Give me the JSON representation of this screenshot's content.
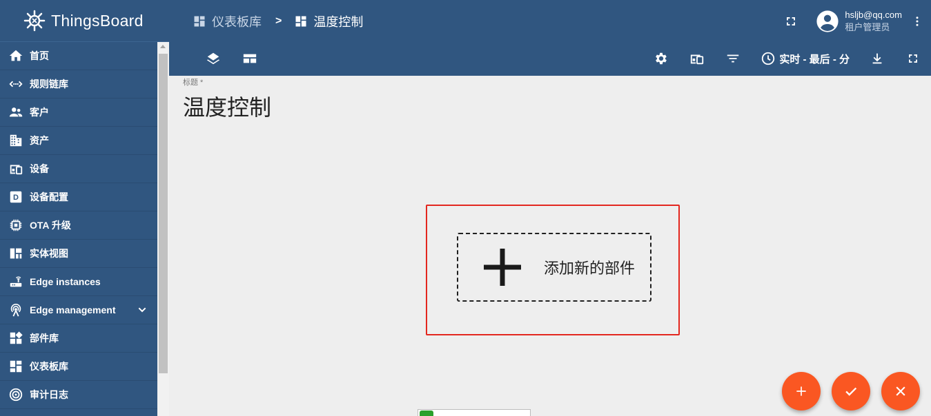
{
  "app": {
    "name": "ThingsBoard"
  },
  "sidebar": {
    "items": [
      {
        "label": "首页",
        "icon": "home-icon"
      },
      {
        "label": "规则链库",
        "icon": "rule-chain-icon"
      },
      {
        "label": "客户",
        "icon": "customers-icon"
      },
      {
        "label": "资产",
        "icon": "assets-icon"
      },
      {
        "label": "设备",
        "icon": "devices-icon"
      },
      {
        "label": "设备配置",
        "icon": "device-profile-icon"
      },
      {
        "label": "OTA 升级",
        "icon": "chip-icon"
      },
      {
        "label": "实体视图",
        "icon": "entity-view-icon"
      },
      {
        "label": "Edge instances",
        "icon": "router-icon"
      },
      {
        "label": "Edge management",
        "icon": "antenna-icon",
        "expandable": true
      },
      {
        "label": "部件库",
        "icon": "widgets-icon"
      },
      {
        "label": "仪表板库",
        "icon": "dashboard-icon"
      },
      {
        "label": "审计日志",
        "icon": "audit-log-icon"
      }
    ]
  },
  "header": {
    "breadcrumb": [
      {
        "label": "仪表板库",
        "icon": "dashboard-icon"
      },
      {
        "label": "温度控制",
        "icon": "dashboard-icon"
      }
    ],
    "separator": ">",
    "user": {
      "email": "hsljb@qq.com",
      "role": "租户管理员"
    }
  },
  "toolbar": {
    "time_window": "实时 - 最后 - 分"
  },
  "dashboard": {
    "title_label": "标题 *",
    "title": "温度控制",
    "add_widget_label": "添加新的部件"
  },
  "fabs": [
    {
      "icon": "plus-icon",
      "color": "#fa5722"
    },
    {
      "icon": "check-icon",
      "color": "#fa5722"
    },
    {
      "icon": "close-icon",
      "color": "#fa5722"
    }
  ],
  "colors": {
    "primary": "#305680",
    "accent": "#fa5722",
    "highlight": "#e3261e"
  }
}
